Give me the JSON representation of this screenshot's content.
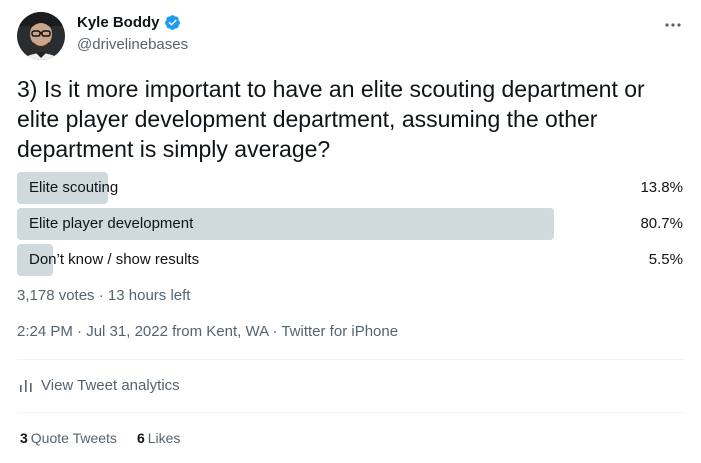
{
  "author": {
    "display_name": "Kyle Boddy",
    "handle": "@drivelinebases",
    "verified": true,
    "avatar_icon": "avatar-photo"
  },
  "tweet": {
    "text": "3) Is it more important to have an elite scouting department or elite player development department, assuming the other department is simply average?"
  },
  "poll": {
    "options": [
      {
        "label": "Elite scouting",
        "percent_text": "13.8%",
        "percent": 13.8
      },
      {
        "label": "Elite player development",
        "percent_text": "80.7%",
        "percent": 80.7
      },
      {
        "label": "Don’t know / show results",
        "percent_text": "5.5%",
        "percent": 5.5
      }
    ],
    "votes": "3,178 votes",
    "separator": "·",
    "time_left": "13 hours left"
  },
  "meta": {
    "time": "2:24 PM",
    "date": "Jul 31, 2022",
    "location": "from Kent, WA",
    "source": "Twitter for iPhone",
    "separator": "·"
  },
  "analytics": {
    "label": "View Tweet analytics",
    "icon": "bar-chart-icon"
  },
  "stats": {
    "quote_count": "3",
    "quote_label": "Quote Tweets",
    "like_count": "6",
    "like_label": "Likes"
  },
  "colors": {
    "bar": "#cfd9de",
    "verified": "#1d9bf0",
    "secondary_text": "#536471",
    "primary_text": "#0f1419",
    "divider": "#eff3f4"
  },
  "icons": [
    "avatar-photo",
    "verified-badge-icon",
    "more-options-icon",
    "bar-chart-icon"
  ]
}
